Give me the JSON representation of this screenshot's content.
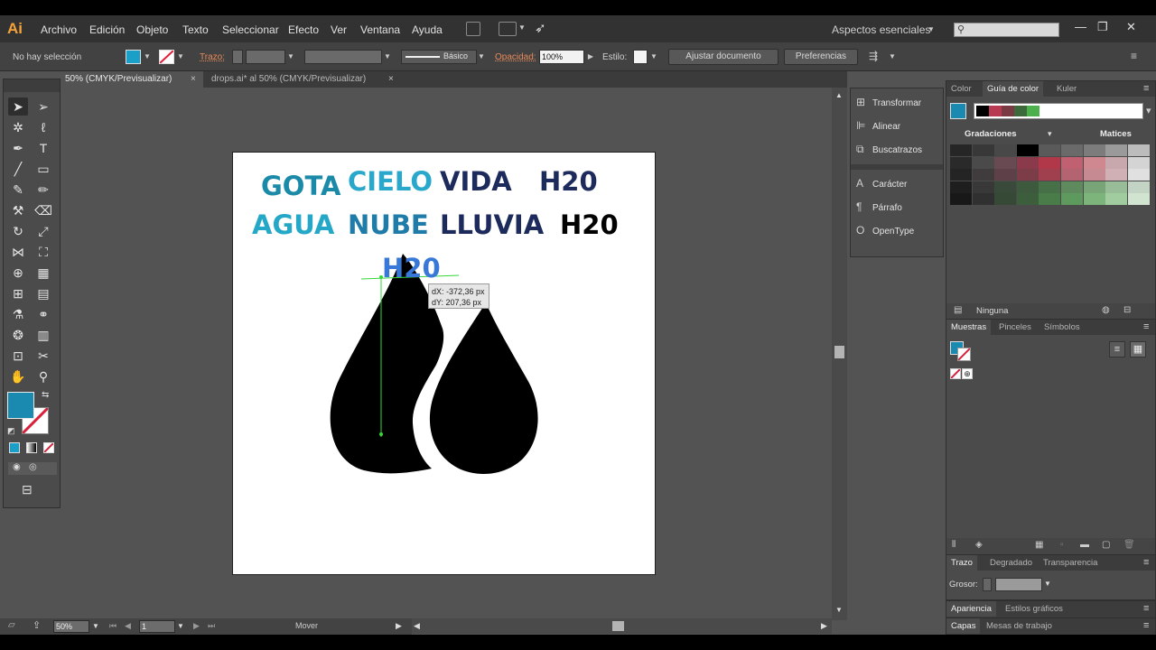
{
  "app": {
    "logo": "Ai"
  },
  "menu": [
    "Archivo",
    "Edición",
    "Objeto",
    "Texto",
    "Seleccionar",
    "Efecto",
    "Ver",
    "Ventana",
    "Ayuda"
  ],
  "workspace": {
    "label": "Aspectos esenciales",
    "search_icon": "⚲"
  },
  "window_controls": {
    "minimize": "—",
    "restore": "❐",
    "close": "✕"
  },
  "control_bar": {
    "selection": "No hay selección",
    "stroke_label": "Trazo:",
    "stroke_style": "Básico",
    "opacity_label": "Opacidad:",
    "opacity_value": "100%",
    "style_label": "Estilo:",
    "doc_button": "Ajustar documento",
    "prefs_button": "Preferencias",
    "fill_color": "#1aa0c8"
  },
  "tabs": [
    {
      "label": "50% (CMYK/Previsualizar)",
      "close": "×"
    },
    {
      "label": "drops.ai* al 50% (CMYK/Previsualizar)",
      "close": "×"
    }
  ],
  "artboard": {
    "words": [
      {
        "text": "GOTA",
        "color": "#1a8aa8"
      },
      {
        "text": "CIELO",
        "color": "#29a8cc"
      },
      {
        "text": "VIDA",
        "color": "#1c2a5c"
      },
      {
        "text": "H20",
        "color": "#1c2a5c"
      },
      {
        "text": "AGUA",
        "color": "#25a8c8"
      },
      {
        "text": "NUBE",
        "color": "#1f7ba8"
      },
      {
        "text": "LLUVIA",
        "color": "#1c2a5c"
      },
      {
        "text": "H20",
        "color": "#000000"
      },
      {
        "text": "H20",
        "color": "#3878d8"
      }
    ],
    "tooltip": {
      "dx": "dX: -372,36 px",
      "dy": "dY: 207,36 px"
    }
  },
  "status": {
    "zoom": "50%",
    "page": "1",
    "tool": "Mover"
  },
  "dock": [
    "Transformar",
    "Alinear",
    "Buscatrazos",
    "Carácter",
    "Párrafo",
    "OpenType"
  ],
  "dock_icons": [
    "transform-icon",
    "align-icon",
    "pathfinder-icon",
    "character-icon",
    "paragraph-icon",
    "opentype-icon"
  ],
  "color_panel": {
    "tabs": [
      "Color",
      "Guía de color",
      "Kuler"
    ],
    "gradations": "Gradaciones",
    "tints": "Matices",
    "none_label": "Ninguna"
  },
  "swatch_panel": {
    "tabs": [
      "Muestras",
      "Pinceles",
      "Símbolos"
    ]
  },
  "stroke_panel": {
    "tabs": [
      "Trazo",
      "Degradado",
      "Transparencia"
    ],
    "weight_label": "Grosor:"
  },
  "appearance_panel": {
    "tabs": [
      "Apariencia",
      "Estilos gráficos"
    ]
  },
  "layers_panel": {
    "tabs": [
      "Capas",
      "Mesas de trabajo"
    ]
  }
}
